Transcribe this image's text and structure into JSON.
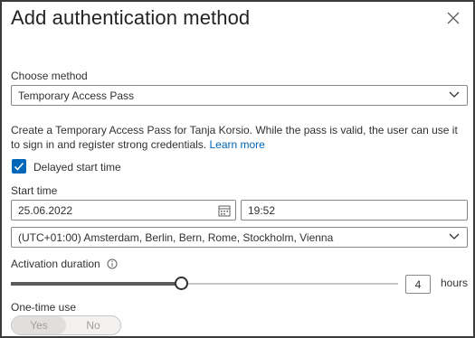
{
  "dialog": {
    "title": "Add authentication method"
  },
  "method": {
    "label": "Choose method",
    "value": "Temporary Access Pass"
  },
  "description": {
    "text": "Create a Temporary Access Pass for Tanja Korsio. While the pass is valid, the user can use it to sign in and register strong credentials.",
    "link": "Learn more"
  },
  "delayed_start": {
    "label": "Delayed start time",
    "checked": true
  },
  "start_time": {
    "label": "Start time",
    "date": "25.06.2022",
    "time": "19:52",
    "timezone": "(UTC+01:00) Amsterdam, Berlin, Bern, Rome, Stockholm, Vienna"
  },
  "activation": {
    "label": "Activation duration",
    "value": "4",
    "unit": "hours",
    "slider_fraction": 0.44
  },
  "one_time": {
    "label": "One-time use",
    "yes": "Yes",
    "no": "No",
    "selected": "Yes"
  },
  "colors": {
    "accent": "#0067b8",
    "border": "#8a8886",
    "text": "#323130"
  }
}
